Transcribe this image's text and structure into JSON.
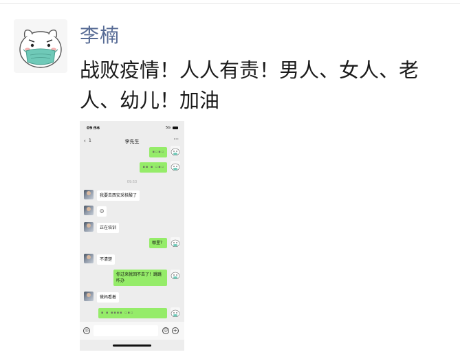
{
  "post": {
    "author": "李楠",
    "text": "战败疫情！人人有责！男人、女人、老人、幼儿！加油"
  },
  "screenshot": {
    "status_time": "09:56",
    "network": "5G",
    "back_icon": "chevron-left-icon",
    "back_count": "1",
    "contact_name": "李先生",
    "more_label": "···",
    "divider_time": "09:53",
    "messages": [
      {
        "from": "me",
        "text": "▪▫▪▫"
      },
      {
        "from": "me",
        "text": "▪▪ ▪ ▫▪▫"
      },
      {
        "from": "friend",
        "text": "我要去西安采核酸了"
      },
      {
        "from": "friend",
        "text": "😊"
      },
      {
        "from": "friend",
        "text": "正在培训"
      },
      {
        "from": "me",
        "text": "哪里？"
      },
      {
        "from": "friend",
        "text": "不清楚"
      },
      {
        "from": "me",
        "text": "你过来就回不去了！跳跳咋办"
      },
      {
        "from": "friend",
        "text": "爸妈看着"
      },
      {
        "from": "me",
        "text": "▪ ▪ ▪▪▪▪ ▫▪▫"
      }
    ],
    "input_icons": [
      "voice-icon",
      "emoji-icon",
      "plus-icon"
    ],
    "voice_glyph": "◎",
    "emoji_glyph": "☺",
    "plus_glyph": "+"
  },
  "colors": {
    "name_blue": "#576b95",
    "bubble_green": "#95ec69",
    "chat_bg": "#ededed"
  }
}
